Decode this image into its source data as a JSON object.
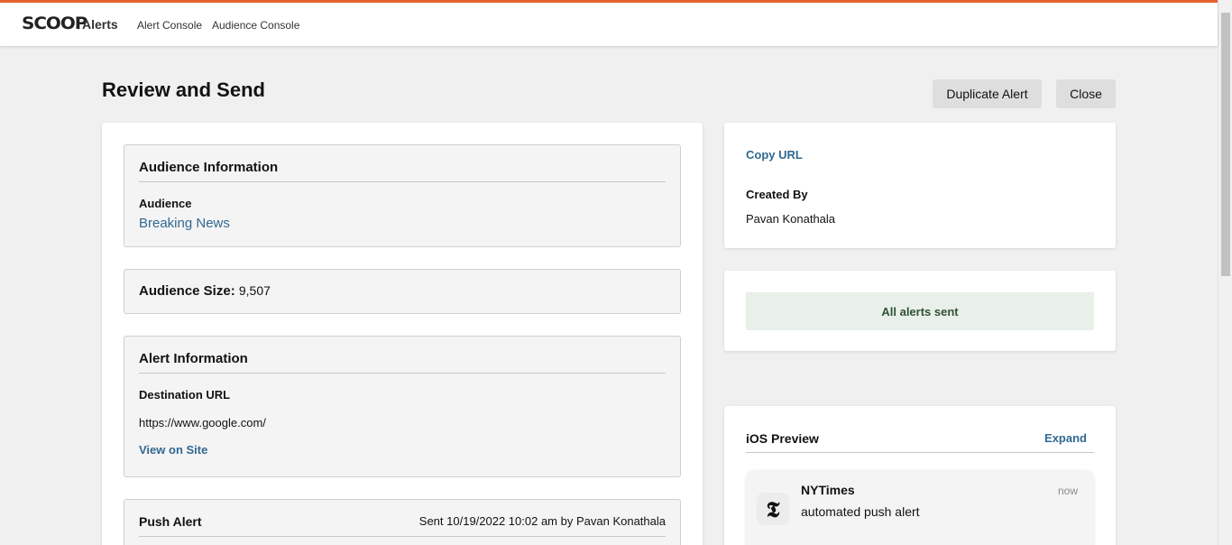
{
  "header": {
    "logo": "SCOOP",
    "app_name": "Alerts",
    "nav": [
      "Alert Console",
      "Audience Console"
    ]
  },
  "page": {
    "title": "Review and Send",
    "duplicate_label": "Duplicate Alert",
    "close_label": "Close"
  },
  "audience_info": {
    "title": "Audience Information",
    "audience_label": "Audience",
    "audience_value": "Breaking News"
  },
  "audience_size": {
    "label": "Audience Size:",
    "value": "9,507"
  },
  "alert_info": {
    "title": "Alert Information",
    "destination_label": "Destination URL",
    "destination_url": "https://www.google.com/",
    "view_on_site": "View on Site"
  },
  "push_alert": {
    "title": "Push Alert",
    "status": "Sent 10/19/2022 10:02 am by Pavan Konathala"
  },
  "meta": {
    "copy_url": "Copy URL",
    "created_by_label": "Created By",
    "created_by": "Pavan Konathala"
  },
  "status": {
    "message": "All alerts sent"
  },
  "ios_preview": {
    "title": "iOS Preview",
    "expand_label": "Expand",
    "app": "NYTimes",
    "time": "now",
    "message": "automated push alert",
    "icon_glyph": "𝕿"
  },
  "colors": {
    "accent": "#e2622b",
    "link": "#326891",
    "success_bg": "#e9efe9",
    "success_text": "#2f5233"
  }
}
